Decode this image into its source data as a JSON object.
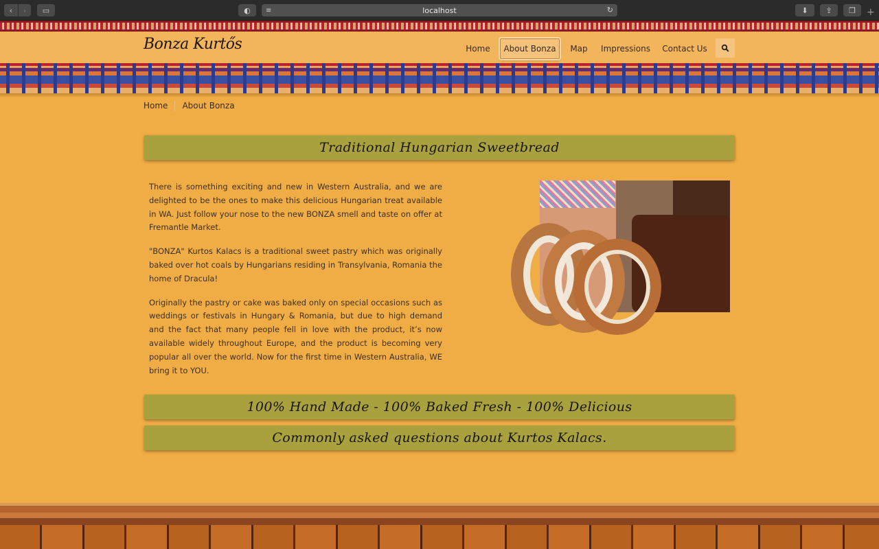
{
  "browser": {
    "url": "localhost"
  },
  "site": {
    "logo": "Bonza Kurtős",
    "nav": [
      {
        "label": "Home"
      },
      {
        "label": "About Bonza"
      },
      {
        "label": "Map"
      },
      {
        "label": "Impressions"
      },
      {
        "label": "Contact Us"
      }
    ],
    "active_nav": "About Bonza"
  },
  "breadcrumb": {
    "home": "Home",
    "current": "About Bonza"
  },
  "main": {
    "heading": "Traditional Hungarian Sweetbread",
    "paragraphs": [
      "There is something exciting and new in Western Australia, and we are delighted to be the ones to make this delicious Hungarian treat available in WA. Just follow your nose to the new BONZA smell and taste on offer at Fremantle Market.",
      "\"BONZA\" Kurtos Kalacs is a traditional sweet pastry which was originally baked over hot coals by Hungarians residing in Transylvania, Romania the home of Dracula!",
      "Originally the pastry or cake was baked only on special occasions such as weddings or festivals in Hungary & Romania, but due to high demand and the fact that many people fell in love with the product, it’s now available widely throughout Europe, and the product is becoming very popular all over the world. Now for the first time in Western Australia, WE bring it to YOU."
    ],
    "banner_fresh": "100% Hand Made - 100% Baked Fresh - 100% Delicious",
    "banner_faq": "Commonly asked questions about Kurtos Kalacs."
  },
  "colors": {
    "banner": "#a9a13e",
    "background": "#f0ad45",
    "accent_red": "#b8232e"
  }
}
